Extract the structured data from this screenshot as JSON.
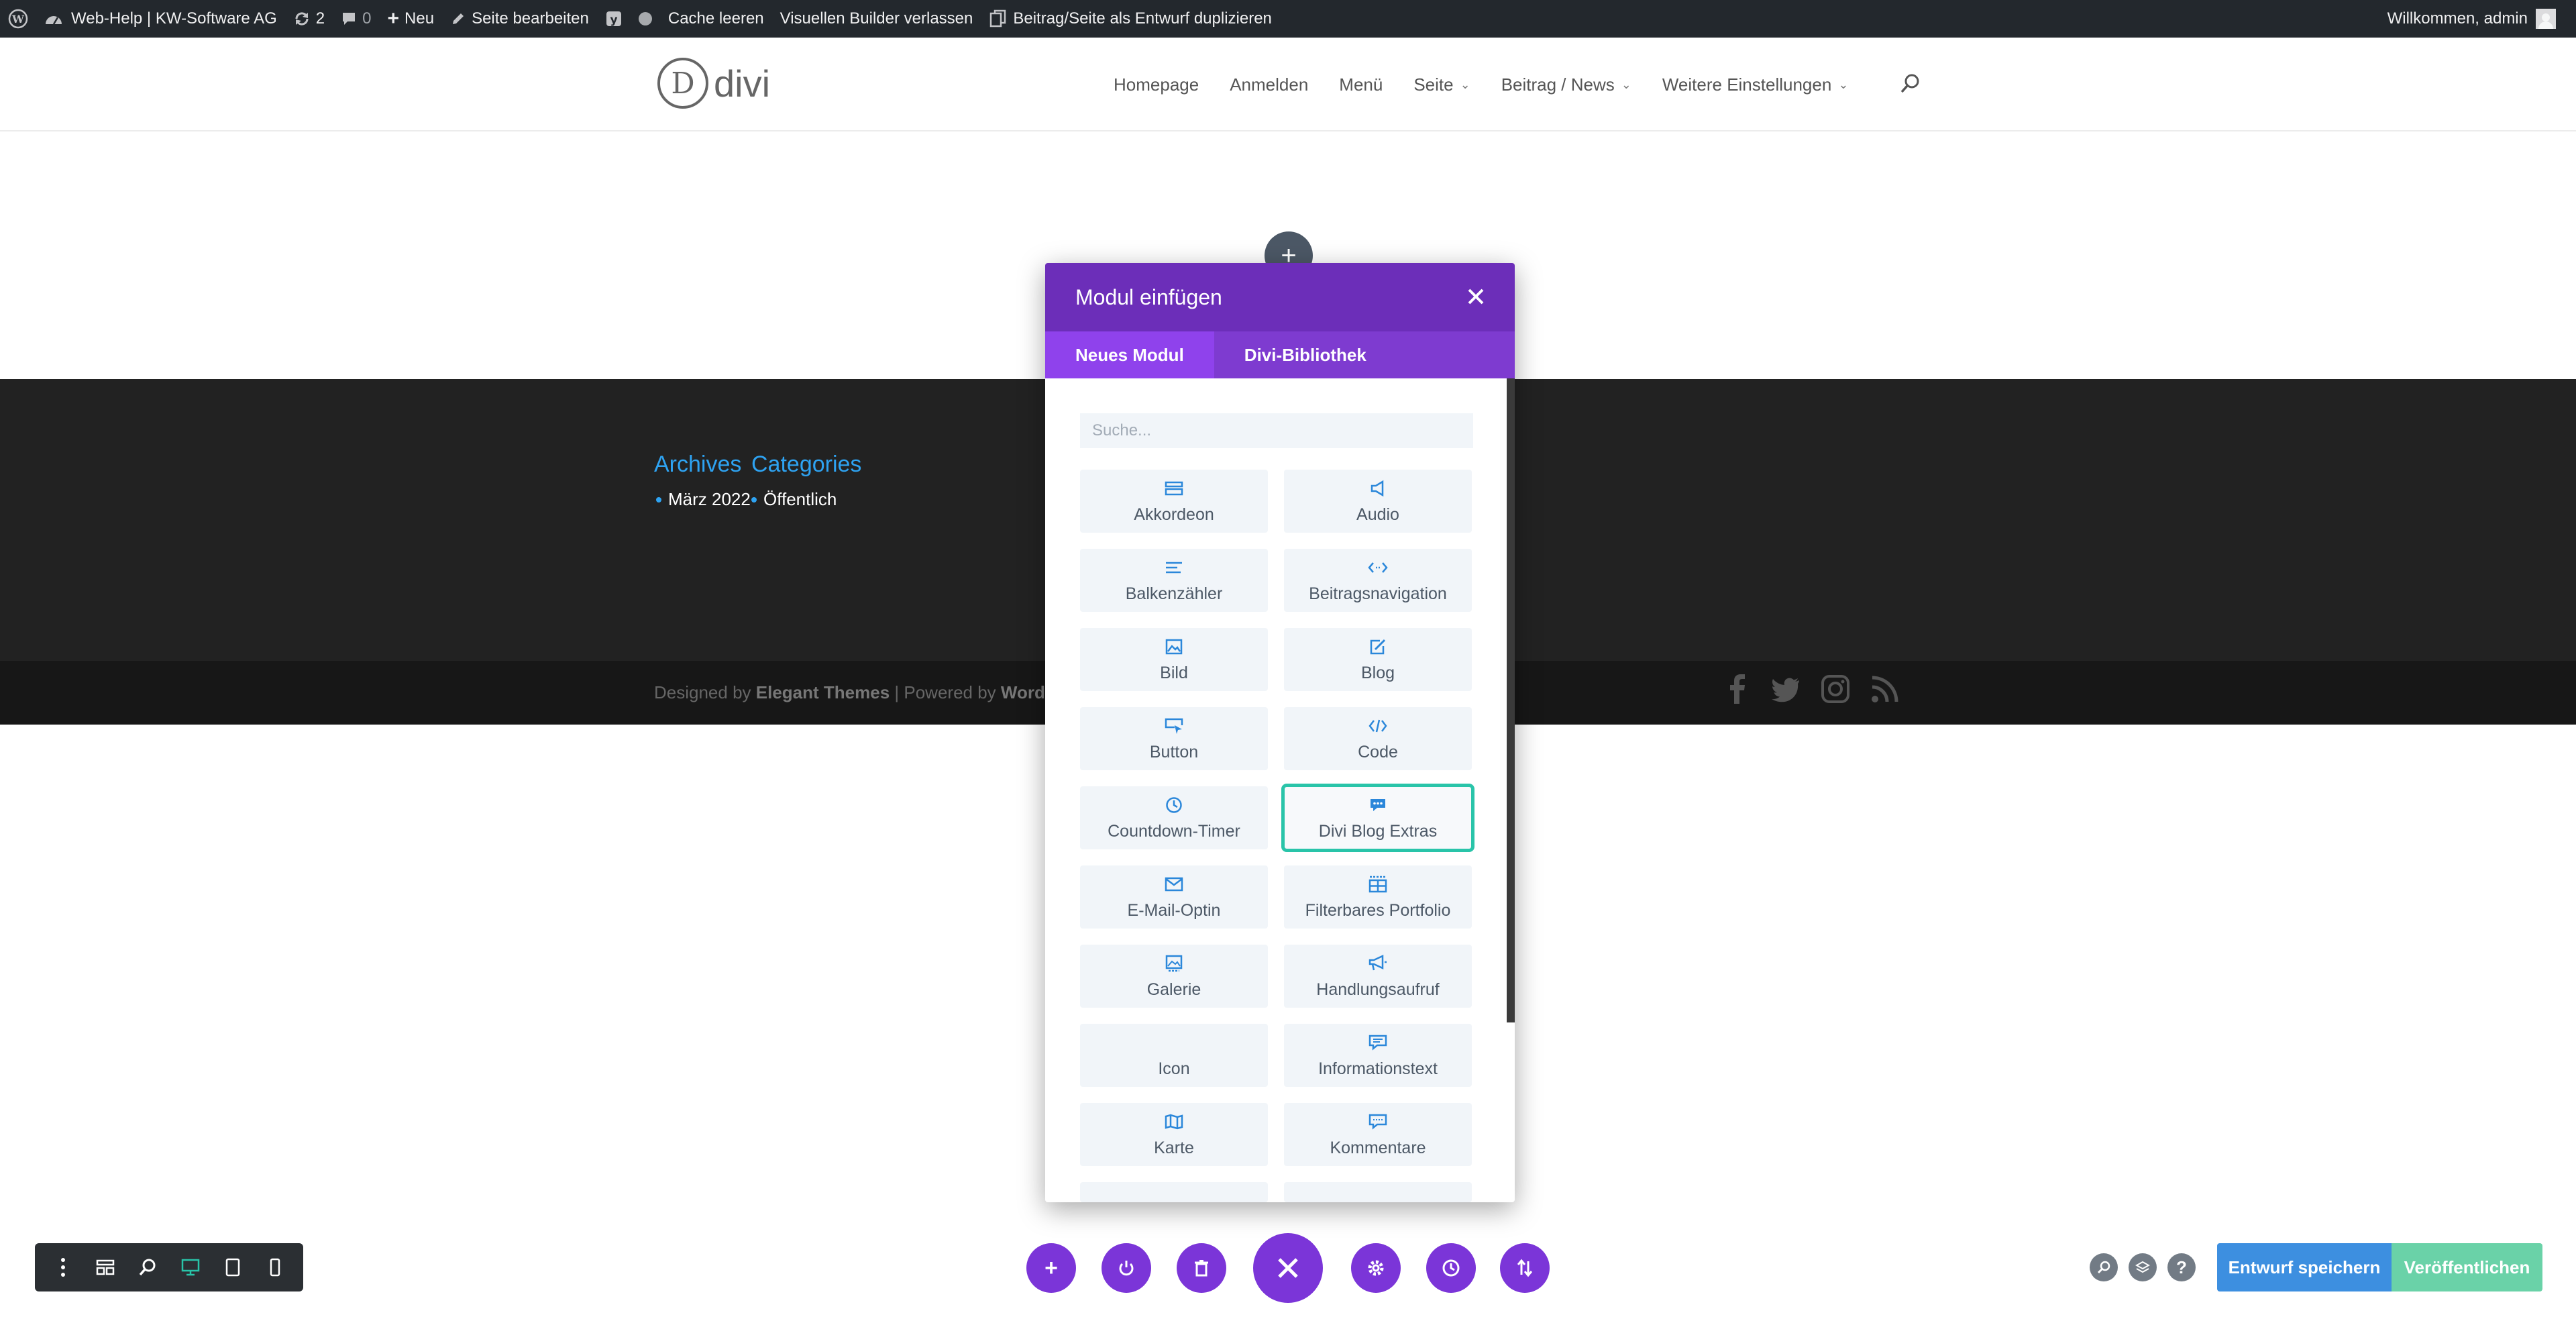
{
  "admin_bar": {
    "site_name": "Web-Help | KW-Software AG",
    "updates_count": "2",
    "comments_count": "0",
    "new_label": "Neu",
    "edit_page_label": "Seite bearbeiten",
    "cache_label": "Cache leeren",
    "exit_builder_label": "Visuellen Builder verlassen",
    "duplicate_label": "Beitrag/Seite als Entwurf duplizieren",
    "welcome_label": "Willkommen, admin"
  },
  "header": {
    "logo_letter": "D",
    "logo_text": "divi",
    "nav": [
      {
        "label": "Homepage"
      },
      {
        "label": "Anmelden"
      },
      {
        "label": "Menü"
      },
      {
        "label": "Seite"
      },
      {
        "label": "Beitrag / News"
      },
      {
        "label": "Weitere Einstellungen"
      }
    ]
  },
  "footer": {
    "archives_title": "Archives",
    "categories_title": "Categories",
    "archive_item": "März 2022",
    "category_item": "Öffentlich",
    "credits_prefix": "Designed by ",
    "credits_theme": "Elegant Themes",
    "credits_mid": " | Powered by ",
    "credits_wp": "WordP"
  },
  "modal": {
    "title": "Modul einfügen",
    "tabs": [
      "Neues Modul",
      "Divi-Bibliothek"
    ],
    "search_placeholder": "Suche...",
    "modules": [
      {
        "label": "Akkordeon",
        "icon": "accordion-icon"
      },
      {
        "label": "Audio",
        "icon": "audio-icon"
      },
      {
        "label": "Balkenzähler",
        "icon": "bar-counter-icon"
      },
      {
        "label": "Beitragsnavigation",
        "icon": "post-nav-icon"
      },
      {
        "label": "Bild",
        "icon": "image-icon"
      },
      {
        "label": "Blog",
        "icon": "blog-icon"
      },
      {
        "label": "Button",
        "icon": "button-icon"
      },
      {
        "label": "Code",
        "icon": "code-icon"
      },
      {
        "label": "Countdown-Timer",
        "icon": "countdown-icon"
      },
      {
        "label": "Divi Blog Extras",
        "icon": "chat-icon"
      },
      {
        "label": "E-Mail-Optin",
        "icon": "email-icon"
      },
      {
        "label": "Filterbares Portfolio",
        "icon": "portfolio-icon"
      },
      {
        "label": "Galerie",
        "icon": "gallery-icon"
      },
      {
        "label": "Handlungsaufruf",
        "icon": "megaphone-icon"
      },
      {
        "label": "Icon",
        "icon": ""
      },
      {
        "label": "Informationstext",
        "icon": "info-text-icon"
      },
      {
        "label": "Karte",
        "icon": "map-icon"
      },
      {
        "label": "Kommentare",
        "icon": "comments-icon"
      }
    ]
  },
  "bottom_bar": {
    "save_label": "Entwurf speichern",
    "publish_label": "Veröffentlichen"
  }
}
